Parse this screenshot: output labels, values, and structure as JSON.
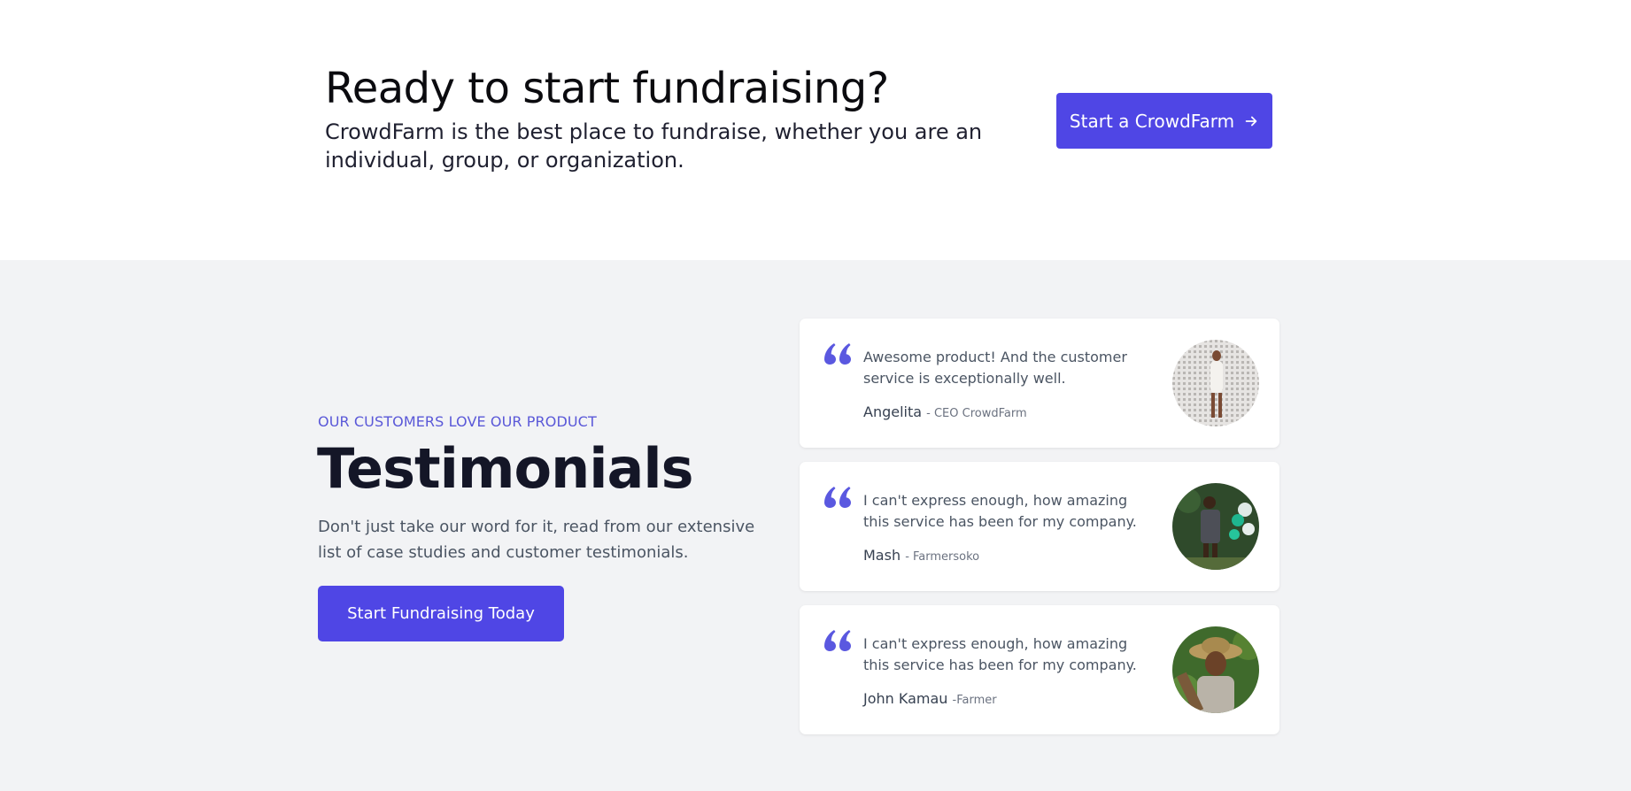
{
  "cta": {
    "title": "Ready to start fundraising?",
    "description": "CrowdFarm is the best place to fundraise, whether you are an individual, group, or organization.",
    "button_label": "Start a CrowdFarm",
    "button_icon": "arrow-right-icon"
  },
  "testimonials": {
    "eyebrow": "OUR CUSTOMERS LOVE OUR PRODUCT",
    "title": "Testimonials",
    "description": "Don't just take our word for it, read from our extensive list of case studies and customer testimonials.",
    "button_label": "Start Fundraising Today",
    "items": [
      {
        "quote": "Awesome product! And the customer service is exceptionally well.",
        "name": "Angelita",
        "role": "- CEO CrowdFarm"
      },
      {
        "quote": "I can't express enough, how amazing this service has been for my company.",
        "name": "Mash",
        "role": "- Farmersoko"
      },
      {
        "quote": "I can't express enough, how amazing this service has been for my company.",
        "name": "John Kamau",
        "role": "-Farmer"
      }
    ]
  },
  "colors": {
    "accent": "#4f46e5",
    "section_bg": "#f2f3f5",
    "quote_mark": "#5a58e0"
  }
}
